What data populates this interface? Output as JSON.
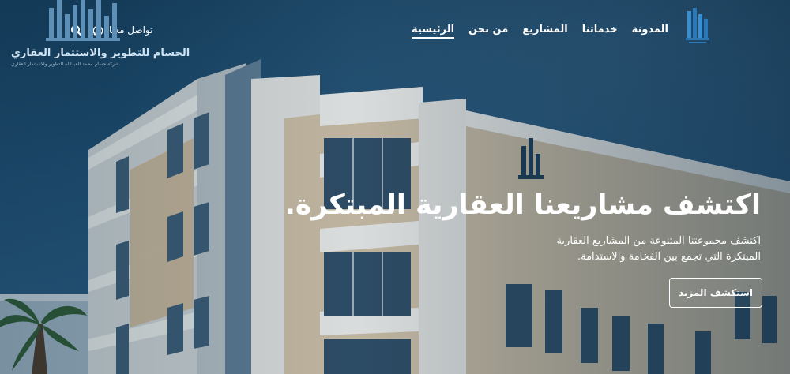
{
  "brand": {
    "name": "الحسام للتطوير والاستثمار العقاري",
    "tagline": "شركة حسام محمد العبدالله للتطوير والاستثمار العقاري"
  },
  "nav": {
    "items": [
      {
        "label": "الرئيسية",
        "active": true
      },
      {
        "label": "من نحن"
      },
      {
        "label": "المشاريع"
      },
      {
        "label": "خدماتنا"
      },
      {
        "label": "المدونة"
      }
    ]
  },
  "header": {
    "contact_label": "تواصل معنا"
  },
  "hero": {
    "headline": "اكتشف مشاريعنا العقارية المبتكرة.",
    "description": "اكتشف مجموعتنا المتنوعة من المشاريع العقارية المبتكرة التي تجمع بين الفخامة والاستدامة.",
    "cta_label": "استكشف المزيد"
  },
  "colors": {
    "overlay": "#16405f",
    "text": "#ffffff"
  }
}
